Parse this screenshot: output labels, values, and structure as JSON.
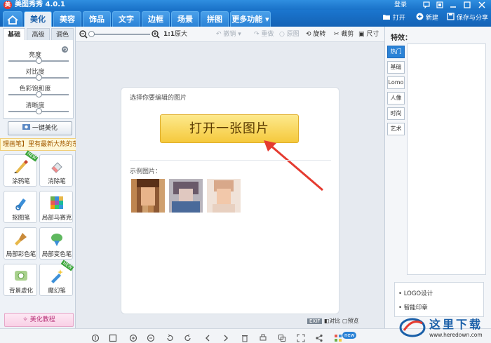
{
  "app": {
    "title": "美图秀秀 4.0.1",
    "login": "登录"
  },
  "tabs": [
    "美化",
    "美容",
    "饰品",
    "文字",
    "边框",
    "场景",
    "拼图",
    "更多功能 ▾"
  ],
  "top_buttons": {
    "open": "打开",
    "new": "新建",
    "save_share": "保存与分享"
  },
  "sidebar": {
    "tabs": [
      "基础",
      "高级",
      "调色"
    ],
    "sliders": [
      {
        "label": "亮度",
        "value": 0.5
      },
      {
        "label": "对比度",
        "value": 0.5
      },
      {
        "label": "色彩饱和度",
        "value": 0.5
      },
      {
        "label": "清晰度",
        "value": 0.5
      }
    ],
    "one_key": "一键美化",
    "tip": "理画笔】里有最新大热的东北大花素材哦，快来试试！",
    "tip_close": "✕",
    "tools": [
      {
        "label": "涂鸦笔",
        "badge": "NEW"
      },
      {
        "label": "消除笔",
        "badge": ""
      },
      {
        "label": "抠图笔",
        "badge": ""
      },
      {
        "label": "局部马赛克",
        "badge": ""
      },
      {
        "label": "局部彩色笔",
        "badge": ""
      },
      {
        "label": "局部变色笔",
        "badge": ""
      },
      {
        "label": "背景虚化",
        "badge": ""
      },
      {
        "label": "魔幻笔",
        "badge": "NEW"
      }
    ],
    "tutorial": "美化教程"
  },
  "toolbar": {
    "ratio": "1:1",
    "enlarge": "原大",
    "undo": "撤销",
    "redo": "重做",
    "reset": "原图",
    "rotate": "旋转",
    "crop": "裁剪",
    "size": "尺寸"
  },
  "canvas": {
    "prompt": "选择你要编辑的图片",
    "open_button": "打开一张图片",
    "samples_label": "示例图片："
  },
  "effects": {
    "label": "特效：",
    "tabs": [
      "热门",
      "基础",
      "Lomo",
      "人像",
      "时尚",
      "艺术"
    ]
  },
  "bottom_list": [
    "LOGO设计",
    "智能印章"
  ],
  "status": {
    "exif": "EXIF",
    "compare": "对比",
    "preview": "预览"
  },
  "bottom_badge": "new",
  "watermark": {
    "text": "这里下载",
    "url": "www.heredown.com"
  },
  "colors": {
    "primary": "#1a72c8",
    "open_button": "#f5c93d",
    "arrow": "#e53b30"
  }
}
